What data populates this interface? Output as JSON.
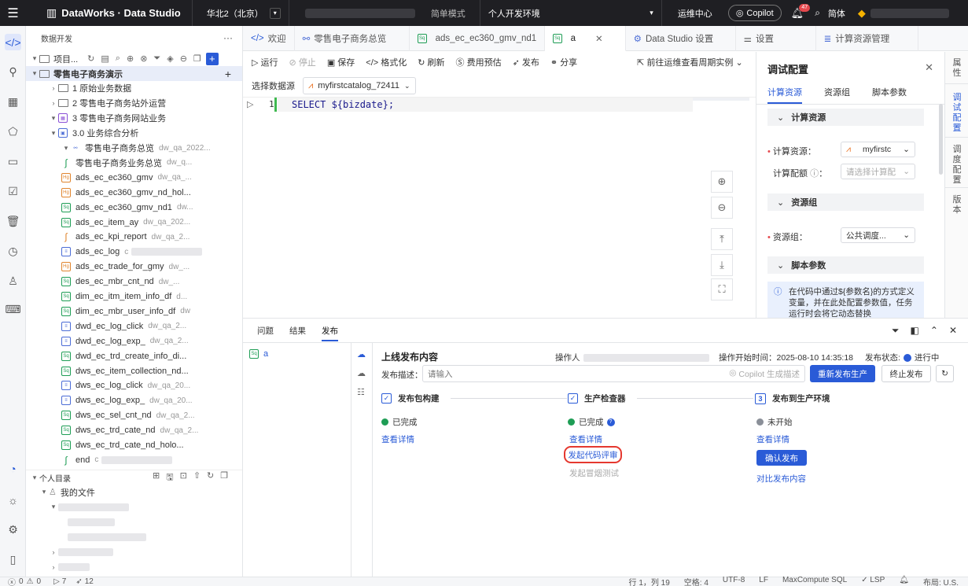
{
  "topbar": {
    "brand": "DataWorks · Data Studio",
    "region": "华北2（北京）",
    "mode": "简单模式",
    "env": "个人开发环境",
    "ops_center": "运维中心",
    "copilot": "Copilot",
    "notif_count": "47",
    "lang": "简体"
  },
  "explorer": {
    "title": "数据开发",
    "project_label": "项目...",
    "tree": [
      {
        "label": "零售电子商务演示",
        "kind": "folder",
        "depth": 0,
        "chevron": "▾",
        "sel": true
      },
      {
        "label": "1 原始业务数据",
        "kind": "folder",
        "depth": 1,
        "chevron": "›"
      },
      {
        "label": "2 零售电子商务站外运营",
        "kind": "folder",
        "depth": 1,
        "chevron": "›"
      },
      {
        "label": "3 零售电子商务网站业务",
        "kind": "biz",
        "depth": 1,
        "chevron": "▾"
      },
      {
        "label": "3.0 业务综合分析",
        "kind": "biz2",
        "depth": 2,
        "chevron": "▾"
      },
      {
        "label": "零售电子商务总览",
        "meta": "dw_qa_2022...",
        "kind": "flow",
        "depth": 3,
        "chevron": "▾"
      },
      {
        "label": "零售电子商务业务总览",
        "meta": "dw_q...",
        "kind": "s",
        "depth": 4
      },
      {
        "label": "ads_ec_ec360_gmv",
        "meta": "dw_qa_...",
        "kind": "orange",
        "depth": 4
      },
      {
        "label": "ads_ec_ec360_gmv_nd_hol...",
        "kind": "orange",
        "depth": 4
      },
      {
        "label": "ads_ec_ec360_gmv_nd1",
        "meta": "dw...",
        "kind": "green",
        "depth": 4
      },
      {
        "label": "ads_ec_item_ay",
        "meta": "dw_qa_202...",
        "kind": "green",
        "depth": 4
      },
      {
        "label": "ads_ec_kpi_report",
        "meta": "dw_qa_2...",
        "kind": "s2",
        "depth": 4
      },
      {
        "label": "ads_ec_log",
        "meta": "c",
        "kind": "blue",
        "depth": 4
      },
      {
        "label": "ads_ec_trade_for_gmy",
        "meta": "dw_...",
        "kind": "orange",
        "depth": 4
      },
      {
        "label": "des_ec_mbr_cnt_nd",
        "meta": "dw_...",
        "kind": "green",
        "depth": 4
      },
      {
        "label": "dim_ec_itm_item_info_df",
        "meta": "d...",
        "kind": "green",
        "depth": 4
      },
      {
        "label": "dim_ec_mbr_user_info_df",
        "meta": "dw",
        "kind": "green",
        "depth": 4
      },
      {
        "label": "dwd_ec_log_click",
        "meta": "dw_qa_2...",
        "kind": "blue",
        "depth": 4
      },
      {
        "label": "dwd_ec_log_exp_",
        "meta": "dw_qa_2...",
        "kind": "blue",
        "depth": 4
      },
      {
        "label": "dwd_ec_trd_create_info_di...",
        "kind": "green",
        "depth": 4
      },
      {
        "label": "dws_ec_item_collection_nd...",
        "kind": "green",
        "depth": 4
      },
      {
        "label": "dws_ec_log_click",
        "meta": "dw_qa_20...",
        "kind": "blue",
        "depth": 4
      },
      {
        "label": "dws_ec_log_exp_",
        "meta": "dw_qa_20...",
        "kind": "blue",
        "depth": 4
      },
      {
        "label": "dws_ec_sel_cnt_nd",
        "meta": "dw_qa_2...",
        "kind": "green",
        "depth": 4
      },
      {
        "label": "dws_ec_trd_cate_nd",
        "meta": "dw_qa_2...",
        "kind": "green",
        "depth": 4
      },
      {
        "label": "dws_ec_trd_cate_nd_holo...",
        "kind": "green",
        "depth": 4
      },
      {
        "label": "end",
        "meta": "c",
        "kind": "s",
        "depth": 4
      }
    ],
    "personal": {
      "title": "个人目录",
      "my_files": "我的文件"
    }
  },
  "tabs": [
    {
      "label": "欢迎",
      "icon": "app-icon"
    },
    {
      "label": "零售电子商务总览",
      "icon": "flow-icon"
    },
    {
      "label": "ads_ec_ec360_gmv_nd1",
      "icon": "sql-file-icon"
    },
    {
      "label": "a",
      "icon": "sql-file-icon",
      "active": true
    },
    {
      "label": "Data Studio 设置",
      "icon": "gear-icon"
    },
    {
      "label": "设置",
      "icon": "settings-icon"
    },
    {
      "label": "计算资源管理",
      "icon": "database-icon"
    }
  ],
  "toolbar": {
    "run": "运行",
    "stop": "停止",
    "save": "保存",
    "format": "格式化",
    "refresh": "刷新",
    "cost": "费用预估",
    "publish": "发布",
    "share": "分享",
    "goto_ops": "前往运维查看周期实例"
  },
  "datasource": {
    "label": "选择数据源",
    "value": "myfirstcatalog_72411"
  },
  "editor": {
    "line_no": "1",
    "code": "SELECT ${bizdate};"
  },
  "config": {
    "title": "调试配置",
    "tabs": [
      "计算资源",
      "资源组",
      "脚本参数"
    ],
    "section_compute": "计算资源",
    "compute_label": "计算资源：",
    "compute_value": "myfirstc",
    "quota_label": "计算配额",
    "quota_placeholder": "请选择计算配",
    "section_rg": "资源组",
    "rg_label": "资源组：",
    "rg_value": "公共调度...",
    "section_params": "脚本参数",
    "info": "在代码中通过${参数名}的方式定义变量，并在此处配置参数值，任务运行时会将它动态替换"
  },
  "vtabs": [
    "属性",
    "调试配置",
    "调度配置",
    "版本"
  ],
  "bottom": {
    "tabs": [
      "问题",
      "结果",
      "发布"
    ],
    "left_item": "a",
    "title": "上线发布内容",
    "operator_label": "操作人",
    "start_label": "操作开始时间：2025-08-10 14:35:18",
    "status_label": "发布状态:",
    "status_value": "进行中",
    "desc_label": "发布描述：",
    "desc_placeholder": "请输入",
    "copilot_gen": "Copilot 生成描述",
    "republish": "重新发布生产",
    "stop_publish": "终止发布",
    "step1": {
      "title": "发布包构建",
      "state": "已完成",
      "link": "查看详情"
    },
    "step2": {
      "title": "生产检查器",
      "state": "已完成",
      "link": "查看详情",
      "review": "发起代码评审",
      "smoke": "发起冒烟测试"
    },
    "step3": {
      "num": "3",
      "title": "发布到生产环境",
      "state": "未开始",
      "link": "查看详情",
      "confirm": "确认发布",
      "compare": "对比发布内容"
    }
  },
  "status": {
    "errors": "0",
    "warnings": "0",
    "runs": "7",
    "sends": "12",
    "position": "行 1，列 19",
    "spaces": "空格: 4",
    "encoding": "UTF-8",
    "eol": "LF",
    "lang": "MaxCompute SQL",
    "lsp": "LSP",
    "layout": "布局: U.S."
  }
}
